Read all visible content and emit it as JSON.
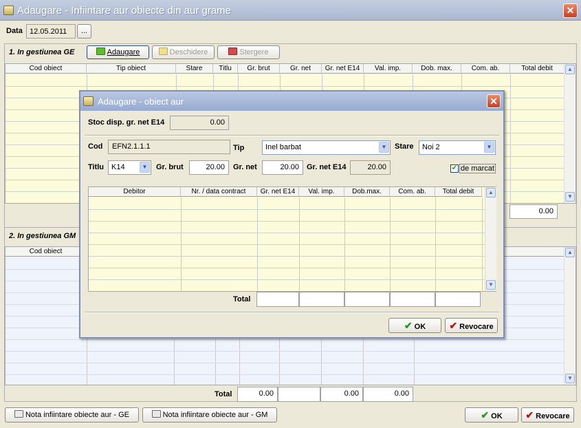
{
  "window": {
    "title": "Adaugare - Infiintare aur obiecte din aur grame"
  },
  "header": {
    "date_label": "Data",
    "date_value": "12.05.2011",
    "date_picker_label": "..."
  },
  "section1": {
    "title": "1. In gestiunea GE",
    "btn_add": "Adaugare",
    "btn_open": "Deschidere",
    "btn_delete": "Stergere",
    "columns": [
      "Cod obiect",
      "Tip obiect",
      "Stare",
      "Titlu",
      "Gr. brut",
      "Gr. net",
      "Gr. net E14",
      "Val. imp.",
      "Dob. max.",
      "Com. ab.",
      "Total debit"
    ],
    "total_debit": "0.00"
  },
  "section2": {
    "title": "2. In gestiunea GM",
    "columns": [
      "Cod obiect"
    ],
    "total_label": "Total",
    "totals": [
      "0.00",
      "0.00",
      "0.00"
    ]
  },
  "footer": {
    "btn_note_ge": "Nota infiintare obiecte aur - GE",
    "btn_note_gm": "Nota infiintare obiecte aur - GM",
    "ok": "OK",
    "cancel": "Revocare"
  },
  "dialog": {
    "title": "Adaugare - obiect aur",
    "stock_label": "Stoc disp. gr. net E14",
    "stock_value": "0.00",
    "cod_label": "Cod",
    "cod_value": "EFN2.1.1.1",
    "tip_label": "Tip",
    "tip_value": "Inel barbat",
    "stare_label": "Stare",
    "stare_value": "Noi 2",
    "titlu_label": "Titlu",
    "titlu_value": "K14",
    "grbrut_label": "Gr. brut",
    "grbrut_value": "20.00",
    "grnet_label": "Gr. net",
    "grnet_value": "20.00",
    "grnete14_label": "Gr. net E14",
    "grnete14_value": "20.00",
    "demarcat_label": "de marcat",
    "demarcat_checked": true,
    "columns": [
      "Debitor",
      "Nr. / data contract",
      "Gr. net E14",
      "Val. imp.",
      "Dob.max.",
      "Com. ab.",
      "Total debit"
    ],
    "total_label": "Total",
    "ok": "OK",
    "cancel": "Revocare"
  },
  "colors": {
    "title_bar": "#aab8d0",
    "close_red": "#c84020",
    "grid_yellow": "#fcfcdc",
    "grid_blue": "#eef3fc",
    "ok_green": "#1f9a1f",
    "cancel_red": "#c01010"
  }
}
